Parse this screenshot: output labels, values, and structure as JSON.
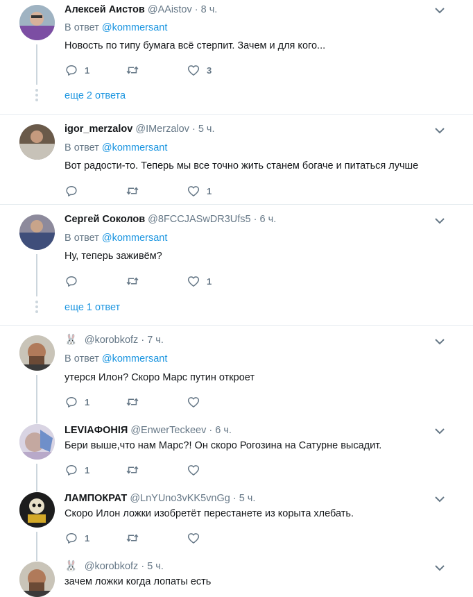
{
  "reply_prefix": "В ответ",
  "tweets": [
    {
      "name": "Алексей Аистов",
      "handle": "@AAistov",
      "sep": "·",
      "time": "8 ч.",
      "reply_to": "@kommersant",
      "text": "Новость по типу бумага всё стерпит. Зачем и для кого...",
      "replies": "1",
      "retweets": "",
      "likes": "3",
      "more_replies": "еще 2 ответа"
    },
    {
      "name": "igor_merzalov",
      "handle": "@IMerzalov",
      "sep": "·",
      "time": "5 ч.",
      "reply_to": "@kommersant",
      "text": "Вот радости-то. Теперь мы все точно жить станем богаче и питаться лучше",
      "replies": "",
      "retweets": "",
      "likes": "1"
    },
    {
      "name": "Сергей Соколов",
      "handle": "@8FCCJASwDR3Ufs5",
      "sep": "·",
      "time": "6 ч.",
      "reply_to": "@kommersant",
      "text": "Ну, теперь заживём?",
      "replies": "",
      "retweets": "",
      "likes": "1",
      "more_replies": "еще 1 ответ"
    },
    {
      "name": "",
      "handle": "@korobkofz",
      "sep": "·",
      "time": "7 ч.",
      "reply_to": "@kommersant",
      "text": "утерся Илон? Скоро Марс путин откроет",
      "replies": "1",
      "retweets": "",
      "likes": ""
    },
    {
      "name": "LEVIAФОНІЯ",
      "handle": "@EnwerTeckeev",
      "sep": "·",
      "time": "6 ч.",
      "text": "Бери выше,что нам Марс?! Он скоро Рогозина на Сатурне высадит.",
      "replies": "1",
      "retweets": "",
      "likes": ""
    },
    {
      "name": "ЛАМПОКРАТ",
      "handle": "@LnYUno3vKK5vnGg",
      "sep": "·",
      "time": "5 ч.",
      "text": "Скоро Илон ложки изобретёт перестанете из корыта хлебать.",
      "replies": "1",
      "retweets": "",
      "likes": ""
    },
    {
      "name": "",
      "handle": "@korobkofz",
      "sep": "·",
      "time": "5 ч.",
      "text": "зачем ложки когда лопаты есть"
    }
  ],
  "icons": {
    "reply": "reply-icon",
    "retweet": "retweet-icon",
    "like": "heart-icon",
    "menu": "chevron-down-icon",
    "bunny": "rabbit-emoji-icon"
  },
  "colors": {
    "link": "#1b95e0",
    "muted": "#657786",
    "line": "#ccd6dd",
    "separator": "#e6ecf0"
  }
}
